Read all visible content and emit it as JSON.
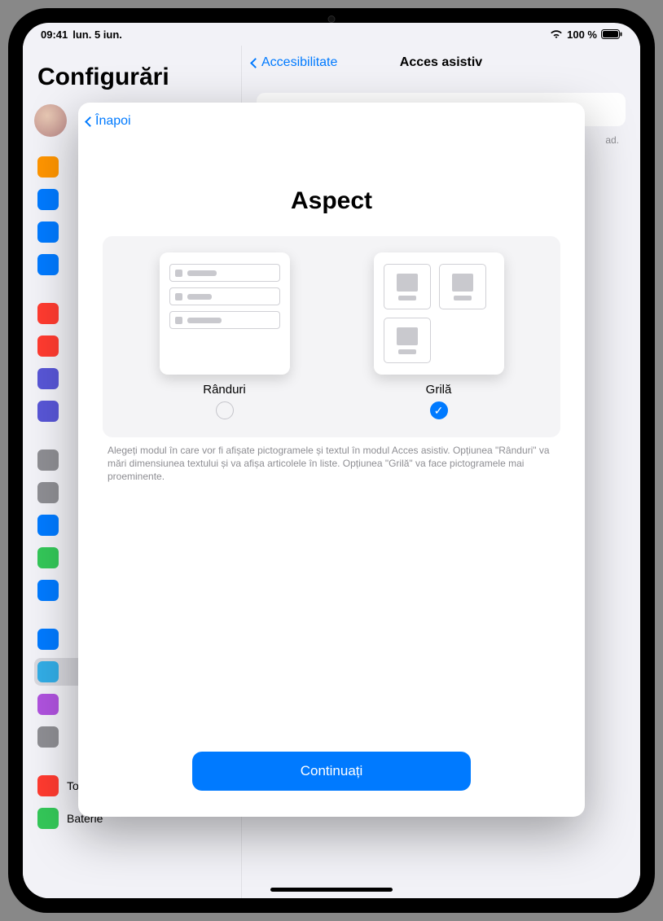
{
  "status": {
    "time": "09:41",
    "date": "lun. 5 iun.",
    "battery_text": "100 %"
  },
  "left_pane": {
    "title": "Configurări",
    "visible_items": {
      "touchid": "Touch ID și cod de acces",
      "battery": "Baterie"
    }
  },
  "detail": {
    "back_label": "Accesibilitate",
    "title": "Acces asistiv",
    "hint_fragment": "ad."
  },
  "modal": {
    "back_label": "Înapoi",
    "title": "Aspect",
    "choices": {
      "rows": "Rânduri",
      "grid": "Grilă"
    },
    "selected": "grid",
    "help_text": "Alegeți modul în care vor fi afișate pictogramele și textul în modul Acces asistiv. Opțiunea \"Rânduri\" va mări dimensiunea textului și va afișa articolele în liste. Opțiunea \"Grilă\" va face pictogramele mai proeminente.",
    "continue_label": "Continuați"
  },
  "colors": {
    "accent": "#007aff",
    "side_icons": [
      "#ff9500",
      "#007aff",
      "#007aff",
      "#007aff",
      "#ff3b30",
      "#ff3b30",
      "#5856d6",
      "#5856d6",
      "#8e8e93",
      "#8e8e93",
      "#007aff",
      "#34c759",
      "#007aff",
      "#007aff",
      "#32ade6",
      "#af52de",
      "#8e8e93",
      "#ff3b30",
      "#34c759"
    ]
  }
}
